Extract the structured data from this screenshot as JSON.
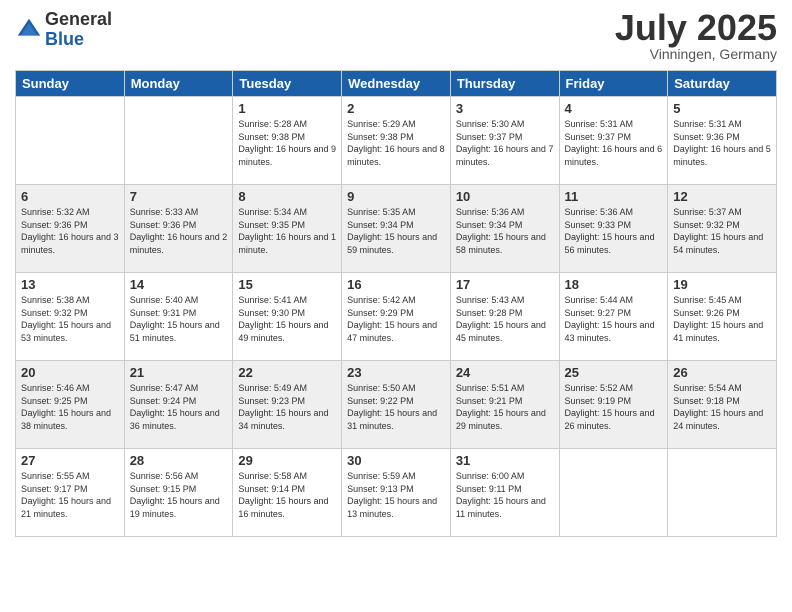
{
  "header": {
    "logo_general": "General",
    "logo_blue": "Blue",
    "month_title": "July 2025",
    "subtitle": "Vinningen, Germany"
  },
  "days_of_week": [
    "Sunday",
    "Monday",
    "Tuesday",
    "Wednesday",
    "Thursday",
    "Friday",
    "Saturday"
  ],
  "weeks": [
    [
      {
        "day": "",
        "info": ""
      },
      {
        "day": "",
        "info": ""
      },
      {
        "day": "1",
        "info": "Sunrise: 5:28 AM\nSunset: 9:38 PM\nDaylight: 16 hours and 9 minutes."
      },
      {
        "day": "2",
        "info": "Sunrise: 5:29 AM\nSunset: 9:38 PM\nDaylight: 16 hours and 8 minutes."
      },
      {
        "day": "3",
        "info": "Sunrise: 5:30 AM\nSunset: 9:37 PM\nDaylight: 16 hours and 7 minutes."
      },
      {
        "day": "4",
        "info": "Sunrise: 5:31 AM\nSunset: 9:37 PM\nDaylight: 16 hours and 6 minutes."
      },
      {
        "day": "5",
        "info": "Sunrise: 5:31 AM\nSunset: 9:36 PM\nDaylight: 16 hours and 5 minutes."
      }
    ],
    [
      {
        "day": "6",
        "info": "Sunrise: 5:32 AM\nSunset: 9:36 PM\nDaylight: 16 hours and 3 minutes."
      },
      {
        "day": "7",
        "info": "Sunrise: 5:33 AM\nSunset: 9:36 PM\nDaylight: 16 hours and 2 minutes."
      },
      {
        "day": "8",
        "info": "Sunrise: 5:34 AM\nSunset: 9:35 PM\nDaylight: 16 hours and 1 minute."
      },
      {
        "day": "9",
        "info": "Sunrise: 5:35 AM\nSunset: 9:34 PM\nDaylight: 15 hours and 59 minutes."
      },
      {
        "day": "10",
        "info": "Sunrise: 5:36 AM\nSunset: 9:34 PM\nDaylight: 15 hours and 58 minutes."
      },
      {
        "day": "11",
        "info": "Sunrise: 5:36 AM\nSunset: 9:33 PM\nDaylight: 15 hours and 56 minutes."
      },
      {
        "day": "12",
        "info": "Sunrise: 5:37 AM\nSunset: 9:32 PM\nDaylight: 15 hours and 54 minutes."
      }
    ],
    [
      {
        "day": "13",
        "info": "Sunrise: 5:38 AM\nSunset: 9:32 PM\nDaylight: 15 hours and 53 minutes."
      },
      {
        "day": "14",
        "info": "Sunrise: 5:40 AM\nSunset: 9:31 PM\nDaylight: 15 hours and 51 minutes."
      },
      {
        "day": "15",
        "info": "Sunrise: 5:41 AM\nSunset: 9:30 PM\nDaylight: 15 hours and 49 minutes."
      },
      {
        "day": "16",
        "info": "Sunrise: 5:42 AM\nSunset: 9:29 PM\nDaylight: 15 hours and 47 minutes."
      },
      {
        "day": "17",
        "info": "Sunrise: 5:43 AM\nSunset: 9:28 PM\nDaylight: 15 hours and 45 minutes."
      },
      {
        "day": "18",
        "info": "Sunrise: 5:44 AM\nSunset: 9:27 PM\nDaylight: 15 hours and 43 minutes."
      },
      {
        "day": "19",
        "info": "Sunrise: 5:45 AM\nSunset: 9:26 PM\nDaylight: 15 hours and 41 minutes."
      }
    ],
    [
      {
        "day": "20",
        "info": "Sunrise: 5:46 AM\nSunset: 9:25 PM\nDaylight: 15 hours and 38 minutes."
      },
      {
        "day": "21",
        "info": "Sunrise: 5:47 AM\nSunset: 9:24 PM\nDaylight: 15 hours and 36 minutes."
      },
      {
        "day": "22",
        "info": "Sunrise: 5:49 AM\nSunset: 9:23 PM\nDaylight: 15 hours and 34 minutes."
      },
      {
        "day": "23",
        "info": "Sunrise: 5:50 AM\nSunset: 9:22 PM\nDaylight: 15 hours and 31 minutes."
      },
      {
        "day": "24",
        "info": "Sunrise: 5:51 AM\nSunset: 9:21 PM\nDaylight: 15 hours and 29 minutes."
      },
      {
        "day": "25",
        "info": "Sunrise: 5:52 AM\nSunset: 9:19 PM\nDaylight: 15 hours and 26 minutes."
      },
      {
        "day": "26",
        "info": "Sunrise: 5:54 AM\nSunset: 9:18 PM\nDaylight: 15 hours and 24 minutes."
      }
    ],
    [
      {
        "day": "27",
        "info": "Sunrise: 5:55 AM\nSunset: 9:17 PM\nDaylight: 15 hours and 21 minutes."
      },
      {
        "day": "28",
        "info": "Sunrise: 5:56 AM\nSunset: 9:15 PM\nDaylight: 15 hours and 19 minutes."
      },
      {
        "day": "29",
        "info": "Sunrise: 5:58 AM\nSunset: 9:14 PM\nDaylight: 15 hours and 16 minutes."
      },
      {
        "day": "30",
        "info": "Sunrise: 5:59 AM\nSunset: 9:13 PM\nDaylight: 15 hours and 13 minutes."
      },
      {
        "day": "31",
        "info": "Sunrise: 6:00 AM\nSunset: 9:11 PM\nDaylight: 15 hours and 11 minutes."
      },
      {
        "day": "",
        "info": ""
      },
      {
        "day": "",
        "info": ""
      }
    ]
  ]
}
